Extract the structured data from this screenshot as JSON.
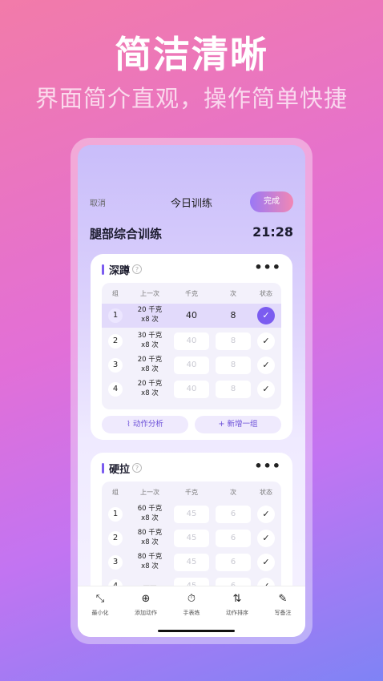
{
  "promo": {
    "headline": "简洁清晰",
    "subline": "界面简介直观，操作简单快捷"
  },
  "topbar": {
    "cancel": "取消",
    "title": "今日训练",
    "done": "完成"
  },
  "workout": {
    "name": "腿部综合训练",
    "timer": "21:28"
  },
  "table_headers": {
    "set": "组",
    "previous": "上一次",
    "kg": "千克",
    "reps": "次",
    "status": "状态"
  },
  "exercise1": {
    "name": "深蹲",
    "help": "?",
    "more": "•••",
    "rows": [
      {
        "set": "1",
        "prev1": "20 千克",
        "prev2": "x8 次",
        "kg": "40",
        "reps": "8",
        "status": "✓"
      },
      {
        "set": "2",
        "prev1": "30 千克",
        "prev2": "x8 次",
        "kg": "40",
        "reps": "8",
        "status": "✓"
      },
      {
        "set": "3",
        "prev1": "20 千克",
        "prev2": "x8 次",
        "kg": "40",
        "reps": "8",
        "status": "✓"
      },
      {
        "set": "4",
        "prev1": "20 千克",
        "prev2": "x8 次",
        "kg": "40",
        "reps": "8",
        "status": "✓"
      }
    ],
    "analysis": "⌇ 动作分析",
    "add_set": "+ 新增一组"
  },
  "exercise2": {
    "name": "硬拉",
    "help": "?",
    "more": "•••",
    "rows": [
      {
        "set": "1",
        "prev1": "60 千克",
        "prev2": "x8 次",
        "kg": "45",
        "reps": "6",
        "status": "✓"
      },
      {
        "set": "2",
        "prev1": "80 千克",
        "prev2": "x8 次",
        "kg": "45",
        "reps": "6",
        "status": "✓"
      },
      {
        "set": "3",
        "prev1": "80 千克",
        "prev2": "x8 次",
        "kg": "45",
        "reps": "6",
        "status": "✓"
      },
      {
        "set": "4",
        "prev1": "——",
        "prev2": "",
        "kg": "45",
        "reps": "6",
        "status": "✓"
      }
    ]
  },
  "tabbar": [
    {
      "icon": "minimize-icon",
      "glyph": "⤡",
      "label": "最小化"
    },
    {
      "icon": "add-circle-icon",
      "glyph": "⊕",
      "label": "添加动作"
    },
    {
      "icon": "stopwatch-icon",
      "glyph": "⏱",
      "label": "手表练"
    },
    {
      "icon": "sort-icon",
      "glyph": "⇅",
      "label": "动作排序"
    },
    {
      "icon": "pen-icon",
      "glyph": "✎",
      "label": "写备注"
    }
  ],
  "colors": {
    "accent": "#7b5cf0",
    "done_gradient_start": "#9a78f6",
    "done_gradient_end": "#f187b4"
  }
}
